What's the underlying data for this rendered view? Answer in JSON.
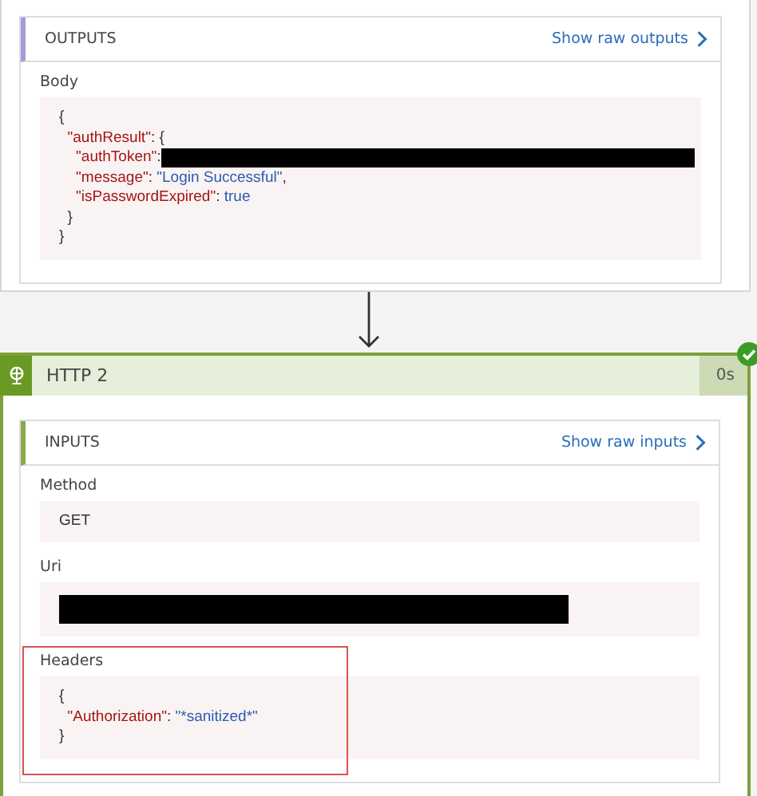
{
  "outputs_panel": {
    "title": "OUTPUTS",
    "link": "Show raw outputs",
    "fields": [
      {
        "label": "Body",
        "highlighted": false,
        "lines": [
          [
            {
              "kind": "punct",
              "text": "{"
            }
          ],
          [
            {
              "kind": "key",
              "text": "  \"authResult\""
            },
            {
              "kind": "punct",
              "text": ": {"
            }
          ],
          [
            {
              "kind": "key",
              "text": "    \"authToken\""
            },
            {
              "kind": "punct",
              "text": ":"
            },
            {
              "kind": "redacted"
            }
          ],
          [
            {
              "kind": "key",
              "text": "    \"message\""
            },
            {
              "kind": "punct",
              "text": ": "
            },
            {
              "kind": "value",
              "text": "\"Login Successful\""
            },
            {
              "kind": "punct",
              "text": ","
            }
          ],
          [
            {
              "kind": "key",
              "text": "    \"isPasswordExpired\""
            },
            {
              "kind": "punct",
              "text": ": "
            },
            {
              "kind": "value",
              "text": "true"
            }
          ],
          [
            {
              "kind": "punct",
              "text": "  }"
            }
          ],
          [
            {
              "kind": "punct",
              "text": "}"
            }
          ]
        ]
      }
    ]
  },
  "step": {
    "title": "HTTP 2",
    "duration": "0s",
    "succeeded": true
  },
  "inputs_panel": {
    "title": "INPUTS",
    "link": "Show raw inputs",
    "fields": [
      {
        "label": "Method",
        "highlighted": false,
        "lines": [
          [
            {
              "kind": "plain",
              "text": "GET"
            }
          ]
        ]
      },
      {
        "label": "Uri",
        "highlighted": false,
        "lines": [
          [
            {
              "kind": "redacted"
            }
          ]
        ]
      },
      {
        "label": "Headers",
        "highlighted": true,
        "lines": [
          [
            {
              "kind": "punct",
              "text": "{"
            }
          ],
          [
            {
              "kind": "key",
              "text": "  \"Authorization\""
            },
            {
              "kind": "punct",
              "text": ": "
            },
            {
              "kind": "value",
              "text": "\"*sanitized*\""
            }
          ],
          [
            {
              "kind": "punct",
              "text": "}"
            }
          ]
        ]
      }
    ]
  }
}
